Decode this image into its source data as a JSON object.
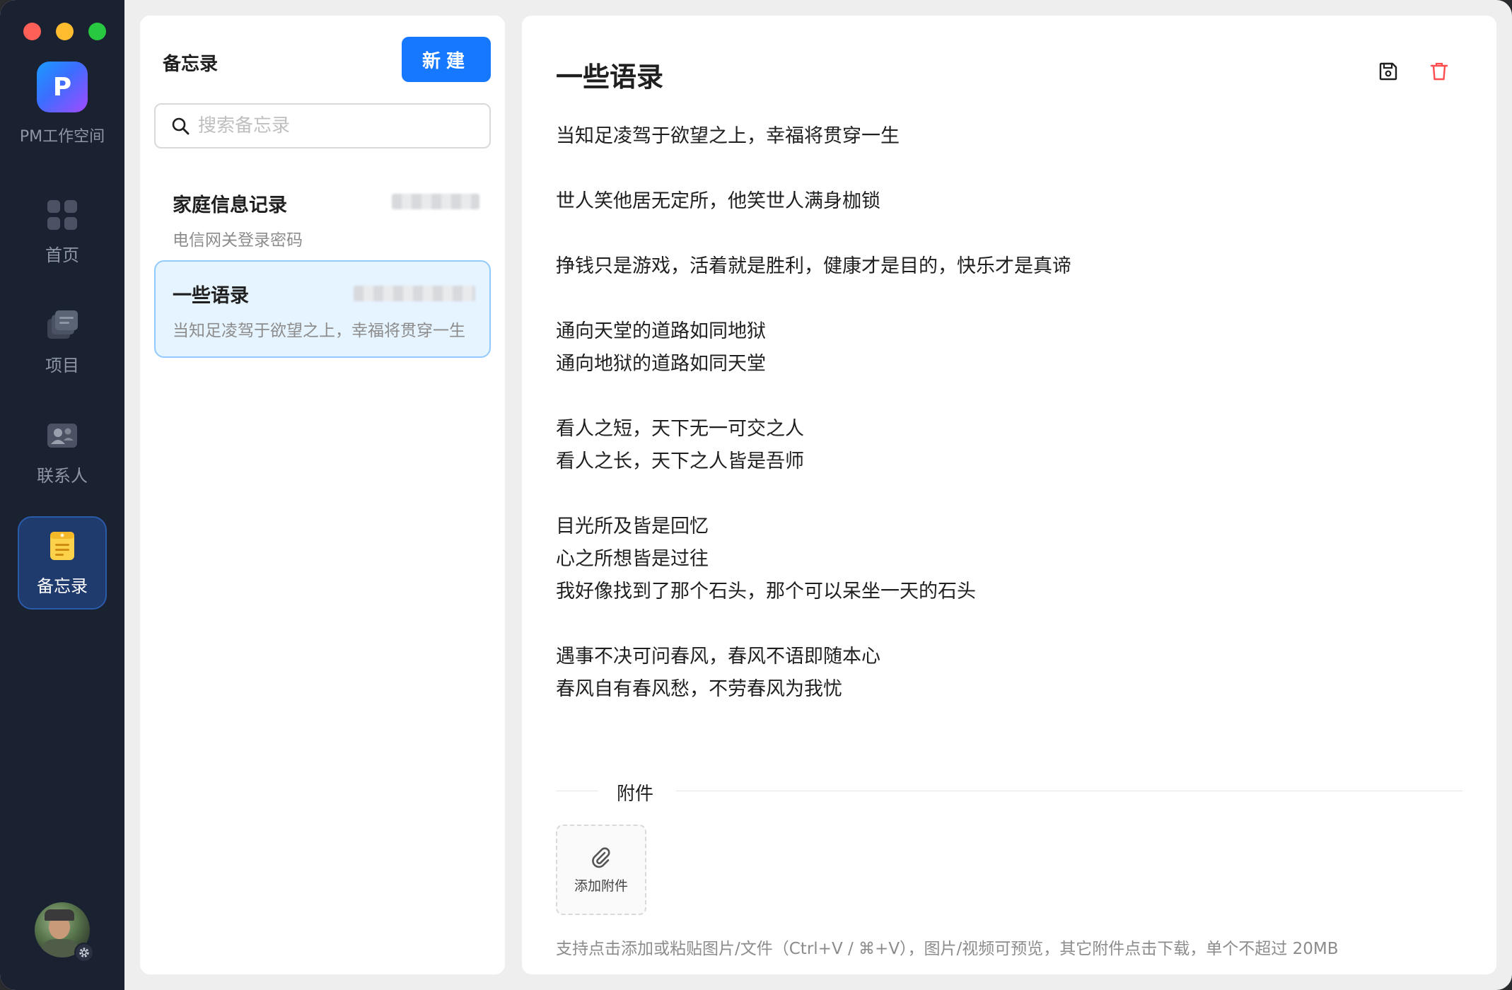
{
  "app": {
    "name": "PM工作空间",
    "logo_letter": "P"
  },
  "nav": {
    "items": [
      {
        "label": "首页",
        "icon": "grid-icon"
      },
      {
        "label": "项目",
        "icon": "stack-icon"
      },
      {
        "label": "联系人",
        "icon": "contacts-icon"
      },
      {
        "label": "备忘录",
        "icon": "memo-icon"
      }
    ],
    "active": "备忘录"
  },
  "list": {
    "title": "备忘录",
    "new_label": "新建",
    "search_placeholder": "搜索备忘录",
    "items": [
      {
        "title": "家庭信息记录",
        "subtitle": "电信网关登录密码"
      },
      {
        "title": "一些语录",
        "subtitle": "当知足凌驾于欲望之上，幸福将贯穿一生"
      }
    ],
    "selected_index": 1
  },
  "editor": {
    "title": "一些语录",
    "lines": [
      "当知足凌驾于欲望之上，幸福将贯穿一生",
      "",
      "世人笑他居无定所，他笑世人满身枷锁",
      "",
      "挣钱只是游戏，活着就是胜利，健康才是目的，快乐才是真谛",
      "",
      "通向天堂的道路如同地狱",
      "通向地狱的道路如同天堂",
      "",
      "看人之短，天下无一可交之人",
      "看人之长，天下之人皆是吾师",
      "",
      "目光所及皆是回忆",
      "心之所想皆是过往",
      "我好像找到了那个石头，那个可以呆坐一天的石头",
      "",
      "遇事不决可问春风，春风不语即随本心",
      "春风自有春风愁，不劳春风为我忧"
    ],
    "attachments_label": "附件",
    "add_attachment_label": "添加附件",
    "hint": "支持点击添加或粘贴图片/文件（Ctrl+V / ⌘+V），图片/视频可预览，其它附件点击下载，单个不超过 20MB"
  },
  "colors": {
    "accent": "#1677ff",
    "rail_bg": "#1a2131",
    "delete": "#ff4d4f",
    "selected_bg": "#e6f4ff"
  }
}
